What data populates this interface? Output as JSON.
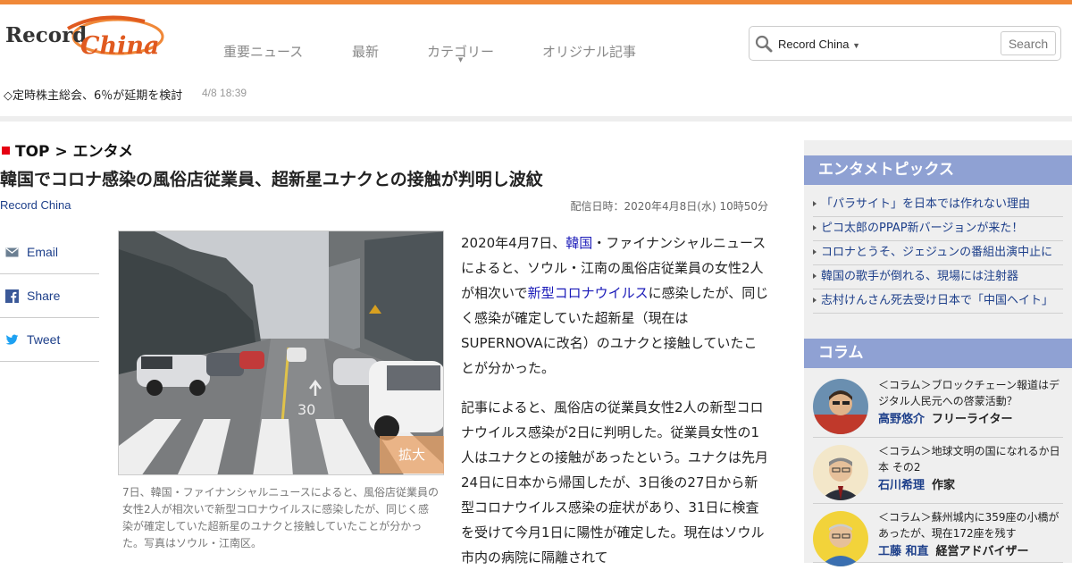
{
  "header": {
    "logo_text": "Record China",
    "nav": [
      "重要ニュース",
      "最新",
      "カテゴリー",
      "オリジナル記事"
    ],
    "search": {
      "scope": "Record China",
      "button": "Search"
    },
    "ticker": {
      "text": "◇定時株主総会、6％が延期を検討",
      "time": "4/8 18:39"
    }
  },
  "breadcrumb": {
    "top": "TOP",
    "separator": ">",
    "category": "エンタメ"
  },
  "article": {
    "title": "韓国でコロナ感染の風俗店従業員、超新星ユナクとの接触が判明し波紋",
    "source": "Record China",
    "date": "配信日時：2020年4月8日(水) 10時50分",
    "share": [
      "Email",
      "Share",
      "Tweet"
    ],
    "zoom_label": "拡大",
    "photo_road_marking": "30",
    "caption": "7日、韓国・ファイナンシャルニュースによると、風俗店従業員の女性2人が相次いで新型コロナウイルスに感染したが、同じく感染が確定していた超新星のユナクと接触していたことが分かった。写真はソウル・江南区。",
    "p1": {
      "t1": "2020年4月7日、",
      "l1": "韓国",
      "t2": "・ファイナンシャルニュースによると、ソウル・江南の風俗店従業員の女性2人が相次いで",
      "l2": "新型コロナウイルス",
      "t3": "に感染したが、同じく感染が確定していた超新星（現在はSUPERNOVAに改名）のユナクと接触していたことが分かった。"
    },
    "p2": "記事によると、風俗店の従業員女性2人の新型コロナウイルス感染が2日に判明した。従業員女性の1人はユナクとの接触があったという。ユナクは先月24日に日本から帰国したが、3日後の27日から新型コロナウイルス感染の症状があり、31日に検査を受けて今月1日に陽性が確定した。現在はソウル市内の病院に隔離されて"
  },
  "sidebar": {
    "topics_title": "エンタメトピックス",
    "topics": [
      "「パラサイト」を日本では作れない理由",
      "ピコ太郎のPPAP新バージョンが来た！",
      "コロナとうそ、ジェジュンの番組出演中止に",
      "韓国の歌手が倒れる、現場には注射器",
      "志村けんさん死去受け日本で「中国ヘイト」"
    ],
    "column_title": "コラム",
    "columns": [
      {
        "title": "＜コラム＞ブロックチェーン報道はデジタル人民元への啓蒙活動？",
        "name": "高野悠介",
        "role": "フリーライター"
      },
      {
        "title": "＜コラム＞地球文明の国になれるか日本 その2",
        "name": "石川希理",
        "role": "作家"
      },
      {
        "title": "＜コラム＞蘇州城内に359座の小橋があったが、現在172座を残す",
        "name": "工藤 和直",
        "role": "経営アドバイザー"
      }
    ]
  },
  "colors": {
    "accent": "#f08838",
    "side_header": "#8fa1d3",
    "link": "#1a1ab8",
    "breadcrumb_marker": "#e60012"
  }
}
